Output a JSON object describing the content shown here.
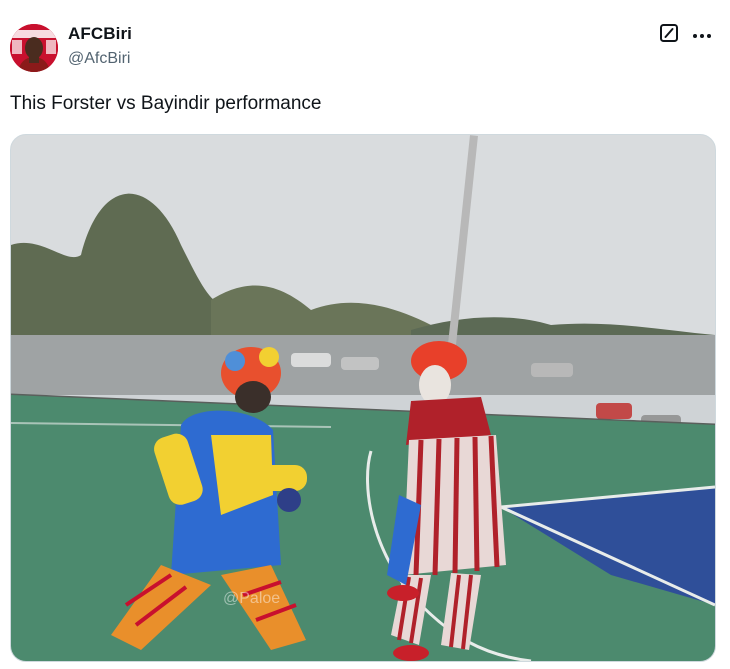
{
  "author": {
    "display_name": "AFCBiri",
    "handle": "@AfcBiri"
  },
  "tweet": {
    "text": "This Forster vs Bayindir performance"
  },
  "media": {
    "watermark": "@Paloe"
  },
  "icons": {
    "grok": "grok-icon",
    "more": "more-icon"
  },
  "colors": {
    "text_primary": "#0f1419",
    "text_secondary": "#536471",
    "border": "#cfd9de",
    "court_green": "#4c8a6e",
    "court_blue": "#2f4f99"
  }
}
